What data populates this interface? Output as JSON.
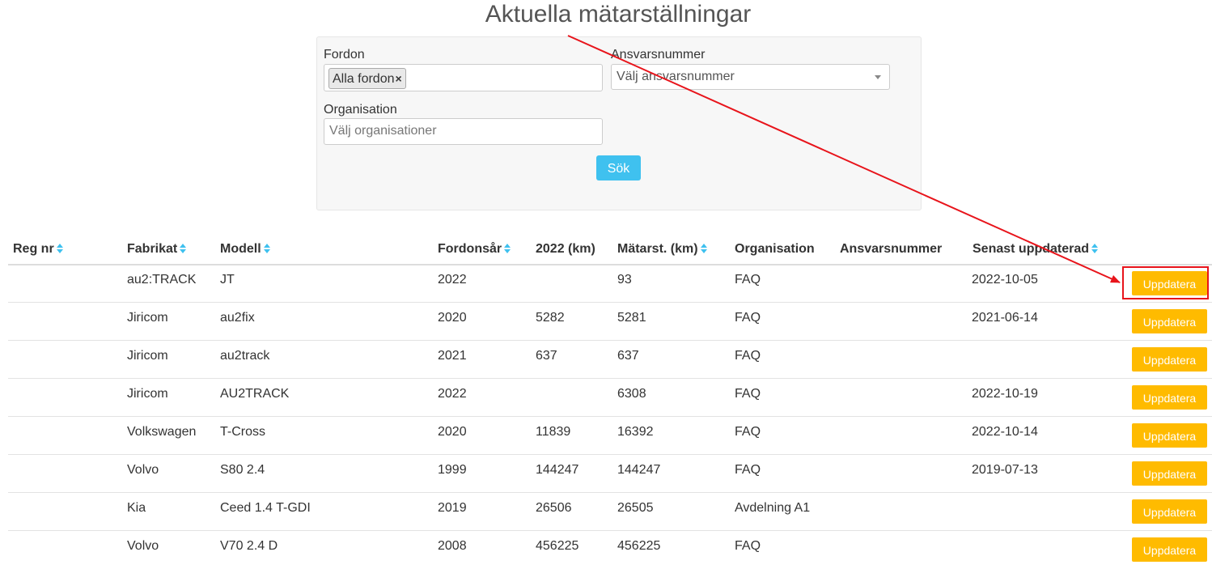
{
  "page": {
    "title": "Aktuella mätarställningar"
  },
  "filters": {
    "fordon_label": "Fordon",
    "fordon_tag": "Alla fordon",
    "fordon_tag_remove": "×",
    "ansvar_label": "Ansvarsnummer",
    "ansvar_placeholder": "Välj ansvarsnummer",
    "org_label": "Organisation",
    "org_placeholder": "Välj organisationer",
    "search_button": "Sök"
  },
  "table": {
    "headers": {
      "regnr": "Reg nr",
      "fabrikat": "Fabrikat",
      "modell": "Modell",
      "fordonsar": "Fordonsår",
      "km2022": "2022 (km)",
      "matarst": "Mätarst. (km)",
      "organisation": "Organisation",
      "ansvarsnummer": "Ansvarsnummer",
      "senast": "Senast uppdaterad"
    },
    "update_label": "Uppdatera",
    "rows": [
      {
        "regnr": "",
        "fabrikat": "au2:TRACK",
        "modell": "JT",
        "fordonsar": "2022",
        "km2022": "",
        "matarst": "93",
        "organisation": "FAQ",
        "ansvarsnummer": "",
        "senast": "2022-10-05"
      },
      {
        "regnr": "",
        "fabrikat": "Jiricom",
        "modell": "au2fix",
        "fordonsar": "2020",
        "km2022": "5282",
        "matarst": "5281",
        "organisation": "FAQ",
        "ansvarsnummer": "",
        "senast": "2021-06-14"
      },
      {
        "regnr": "",
        "fabrikat": "Jiricom",
        "modell": "au2track",
        "fordonsar": "2021",
        "km2022": "637",
        "matarst": "637",
        "organisation": "FAQ",
        "ansvarsnummer": "",
        "senast": ""
      },
      {
        "regnr": "",
        "fabrikat": "Jiricom",
        "modell": "AU2TRACK",
        "fordonsar": "2022",
        "km2022": "",
        "matarst": "6308",
        "organisation": "FAQ",
        "ansvarsnummer": "",
        "senast": "2022-10-19"
      },
      {
        "regnr": "",
        "fabrikat": "Volkswagen",
        "modell": "T-Cross",
        "fordonsar": "2020",
        "km2022": "11839",
        "matarst": "16392",
        "organisation": "FAQ",
        "ansvarsnummer": "",
        "senast": "2022-10-14"
      },
      {
        "regnr": "",
        "fabrikat": "Volvo",
        "modell": "S80 2.4",
        "fordonsar": "1999",
        "km2022": "144247",
        "matarst": "144247",
        "organisation": "FAQ",
        "ansvarsnummer": "",
        "senast": "2019-07-13"
      },
      {
        "regnr": "",
        "fabrikat": "Kia",
        "modell": "Ceed 1.4 T-GDI",
        "fordonsar": "2019",
        "km2022": "26506",
        "matarst": "26505",
        "organisation": "Avdelning A1",
        "ansvarsnummer": "",
        "senast": ""
      },
      {
        "regnr": "",
        "fabrikat": "Volvo",
        "modell": "V70 2.4 D",
        "fordonsar": "2008",
        "km2022": "456225",
        "matarst": "456225",
        "organisation": "FAQ",
        "ansvarsnummer": "",
        "senast": ""
      }
    ]
  },
  "colors": {
    "accent_sort": "#3fc1ef",
    "search_button": "#3fc1ef",
    "update_button": "#ffbb00",
    "annotation": "#e8141b"
  }
}
